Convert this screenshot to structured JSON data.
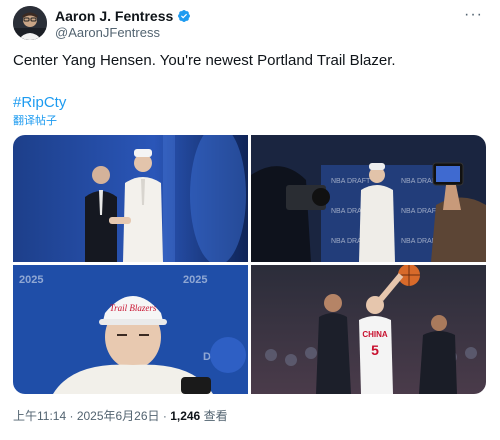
{
  "author": {
    "name": "Aaron J. Fentress",
    "handle": "@AaronJFentress",
    "verified": true
  },
  "tweet": {
    "text": "Center Yang Hensen. You're newest Portland Trail Blazer.",
    "hashtag": "#RipCty",
    "translate_label": "翻译帖子"
  },
  "media": [
    {
      "label": "photo-draft-stage",
      "caption": ""
    },
    {
      "label": "photo-media-cameras",
      "caption": ""
    },
    {
      "label": "photo-cap-closeup",
      "caption": "Trail Blazers"
    },
    {
      "label": "photo-game-action",
      "caption": "CHINA",
      "jersey_number": "5"
    }
  ],
  "footer": {
    "time": "上午11:14",
    "separator": " · ",
    "date": "2025年6月26日",
    "views_count": "1,246",
    "views_label": "查看"
  },
  "colors": {
    "accent": "#1d9bf0",
    "text": "#0f1419",
    "muted": "#536471"
  },
  "icons": {
    "verified": "verified-badge-icon",
    "more": "more-horizontal-icon"
  }
}
